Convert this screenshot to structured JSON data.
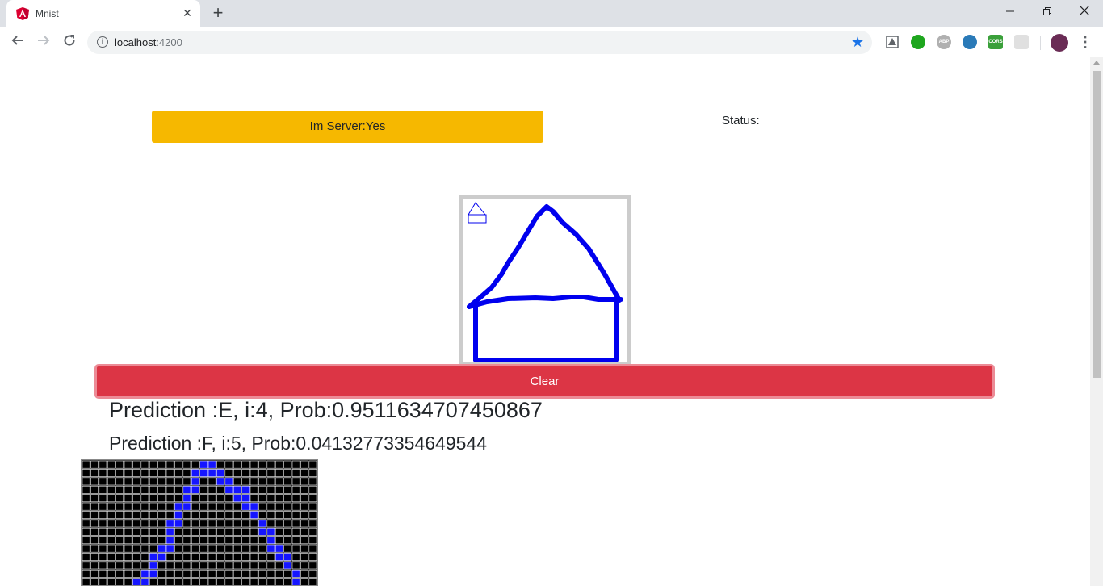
{
  "browser": {
    "tab_title": "Mnist",
    "tab_close": "✕",
    "new_tab": "+",
    "url_host": "localhost",
    "url_port": ":4200",
    "window_controls": [
      "minimize",
      "restore",
      "close"
    ]
  },
  "page": {
    "server_button_label": "Im Server:Yes",
    "status_label": "Status:",
    "clear_button_label": "Clear",
    "predictions": [
      "Prediction :E, i:4, Prob:0.9511634707450867",
      "Prediction :F, i:5, Prob:0.04132773354649544"
    ]
  },
  "colors": {
    "server_button": "#f6b800",
    "clear_button": "#dc3545",
    "stroke": "#0000ee",
    "grid_cell_on": "#1515ff",
    "grid_bg": "#000000",
    "grid_lines": "#ffffff"
  },
  "icons": {
    "favicon": "angular-icon",
    "star": "bookmark-star-icon",
    "info": "site-info-icon",
    "extensions": [
      "drive-icon",
      "green-ball-icon",
      "abp-icon",
      "globe-icon",
      "cors-icon",
      "puzzle-icon"
    ]
  },
  "pixel_grid": {
    "cols": 28,
    "visible_rows": 15,
    "on_cells": [
      [
        0,
        14
      ],
      [
        0,
        15
      ],
      [
        1,
        13
      ],
      [
        1,
        14
      ],
      [
        1,
        15
      ],
      [
        1,
        16
      ],
      [
        2,
        13
      ],
      [
        2,
        16
      ],
      [
        2,
        17
      ],
      [
        3,
        12
      ],
      [
        3,
        13
      ],
      [
        3,
        17
      ],
      [
        3,
        18
      ],
      [
        3,
        19
      ],
      [
        4,
        12
      ],
      [
        4,
        18
      ],
      [
        4,
        19
      ],
      [
        5,
        11
      ],
      [
        5,
        12
      ],
      [
        5,
        19
      ],
      [
        5,
        20
      ],
      [
        6,
        11
      ],
      [
        6,
        20
      ],
      [
        7,
        10
      ],
      [
        7,
        11
      ],
      [
        7,
        21
      ],
      [
        8,
        10
      ],
      [
        8,
        21
      ],
      [
        8,
        22
      ],
      [
        9,
        10
      ],
      [
        9,
        22
      ],
      [
        10,
        9
      ],
      [
        10,
        10
      ],
      [
        10,
        22
      ],
      [
        10,
        23
      ],
      [
        11,
        8
      ],
      [
        11,
        9
      ],
      [
        11,
        23
      ],
      [
        11,
        24
      ],
      [
        12,
        8
      ],
      [
        12,
        24
      ],
      [
        13,
        7
      ],
      [
        13,
        8
      ],
      [
        13,
        25
      ],
      [
        14,
        6
      ],
      [
        14,
        7
      ],
      [
        14,
        25
      ]
    ]
  }
}
